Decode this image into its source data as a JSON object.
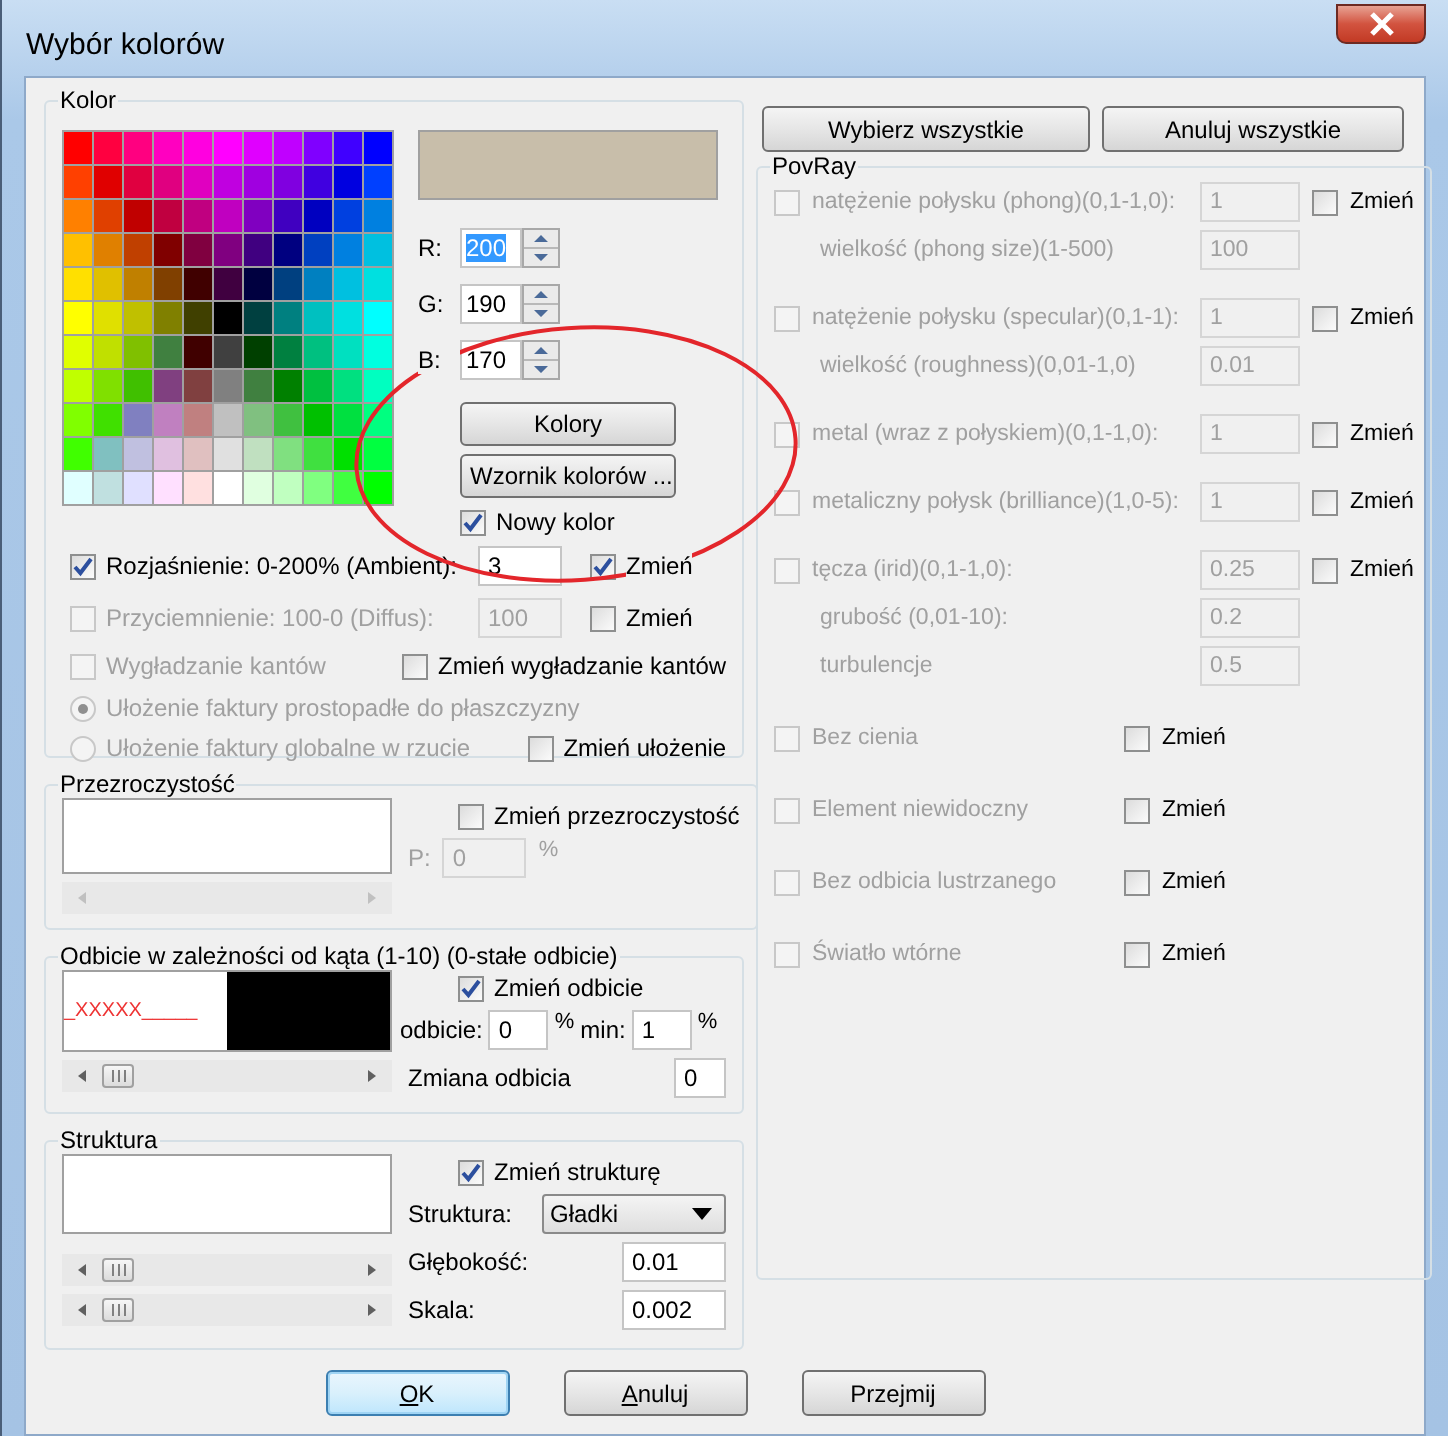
{
  "window": {
    "title": "Wybór kolorów"
  },
  "kolor": {
    "title": "Kolor",
    "palette": [
      {
        "cells": [
          {
            "color": "#ff0000"
          },
          {
            "color": "#ff0040"
          },
          {
            "color": "#ff0080"
          },
          {
            "color": "#ff00c0"
          },
          {
            "color": "#ff00e0"
          },
          {
            "color": "#ff00ff"
          },
          {
            "color": "#e000ff"
          },
          {
            "color": "#c000ff"
          },
          {
            "color": "#8000ff"
          },
          {
            "color": "#4000ff"
          },
          {
            "color": "#0000ff"
          }
        ]
      },
      {
        "cells": [
          {
            "color": "#ff4000"
          },
          {
            "color": "#e00000"
          },
          {
            "color": "#e00040"
          },
          {
            "color": "#e00080"
          },
          {
            "color": "#e000c0"
          },
          {
            "color": "#c000e0"
          },
          {
            "color": "#a000e0"
          },
          {
            "color": "#8000e0"
          },
          {
            "color": "#4000e0"
          },
          {
            "color": "#0000e0"
          },
          {
            "color": "#0040ff"
          }
        ]
      },
      {
        "cells": [
          {
            "color": "#ff8000"
          },
          {
            "color": "#e04000"
          },
          {
            "color": "#c00000"
          },
          {
            "color": "#c00040"
          },
          {
            "color": "#c00080"
          },
          {
            "color": "#c000c0"
          },
          {
            "color": "#8000c0"
          },
          {
            "color": "#4000c0"
          },
          {
            "color": "#0000c0"
          },
          {
            "color": "#0040e0"
          },
          {
            "color": "#0080e0"
          }
        ]
      },
      {
        "cells": [
          {
            "color": "#ffc000"
          },
          {
            "color": "#e08000"
          },
          {
            "color": "#c04000"
          },
          {
            "color": "#800000"
          },
          {
            "color": "#800040"
          },
          {
            "color": "#800080"
          },
          {
            "color": "#400080"
          },
          {
            "color": "#000080"
          },
          {
            "color": "#0040c0"
          },
          {
            "color": "#0080e0"
          },
          {
            "color": "#00c0e0"
          }
        ]
      },
      {
        "cells": [
          {
            "color": "#ffe000"
          },
          {
            "color": "#e0c000"
          },
          {
            "color": "#c08000"
          },
          {
            "color": "#804000"
          },
          {
            "color": "#400000"
          },
          {
            "color": "#400040"
          },
          {
            "color": "#000040"
          },
          {
            "color": "#004080"
          },
          {
            "color": "#0080c0"
          },
          {
            "color": "#00c0e0"
          },
          {
            "color": "#00e0e0"
          }
        ]
      },
      {
        "cells": [
          {
            "color": "#ffff00"
          },
          {
            "color": "#e0e000"
          },
          {
            "color": "#c0c000"
          },
          {
            "color": "#808000"
          },
          {
            "color": "#404000"
          },
          {
            "color": "#000000"
          },
          {
            "color": "#004040"
          },
          {
            "color": "#008080"
          },
          {
            "color": "#00c0c0"
          },
          {
            "color": "#00e0e0"
          },
          {
            "color": "#00ffff"
          }
        ]
      },
      {
        "cells": [
          {
            "color": "#e0ff00"
          },
          {
            "color": "#c0e000"
          },
          {
            "color": "#80c000"
          },
          {
            "color": "#408040"
          },
          {
            "color": "#400000"
          },
          {
            "color": "#404040"
          },
          {
            "color": "#004000"
          },
          {
            "color": "#008040"
          },
          {
            "color": "#00c080"
          },
          {
            "color": "#00e0c0"
          },
          {
            "color": "#00ffe0"
          }
        ]
      },
      {
        "cells": [
          {
            "color": "#c0ff00"
          },
          {
            "color": "#80e000"
          },
          {
            "color": "#40c000"
          },
          {
            "color": "#804080"
          },
          {
            "color": "#804040"
          },
          {
            "color": "#808080"
          },
          {
            "color": "#408040"
          },
          {
            "color": "#008000"
          },
          {
            "color": "#00c040"
          },
          {
            "color": "#00e080"
          },
          {
            "color": "#00ffc0"
          }
        ]
      },
      {
        "cells": [
          {
            "color": "#80ff00"
          },
          {
            "color": "#40e000"
          },
          {
            "color": "#8080c0"
          },
          {
            "color": "#c080c0"
          },
          {
            "color": "#c08080"
          },
          {
            "color": "#c0c0c0"
          },
          {
            "color": "#80c080"
          },
          {
            "color": "#40c040"
          },
          {
            "color": "#00c000"
          },
          {
            "color": "#00e040"
          },
          {
            "color": "#00ff80"
          }
        ]
      },
      {
        "cells": [
          {
            "color": "#40ff00"
          },
          {
            "color": "#80c0c0"
          },
          {
            "color": "#c0c0e0"
          },
          {
            "color": "#e0c0e0"
          },
          {
            "color": "#e0c0c0"
          },
          {
            "color": "#e0e0e0"
          },
          {
            "color": "#c0e0c0"
          },
          {
            "color": "#80e080"
          },
          {
            "color": "#40e040"
          },
          {
            "color": "#00e000"
          },
          {
            "color": "#00ff40"
          }
        ]
      },
      {
        "cells": [
          {
            "color": "#e0ffff"
          },
          {
            "color": "#c0e0e0"
          },
          {
            "color": "#e0e0ff"
          },
          {
            "color": "#ffe0ff"
          },
          {
            "color": "#ffe0e0"
          },
          {
            "color": "#ffffff"
          },
          {
            "color": "#e0ffe0"
          },
          {
            "color": "#c0ffc0"
          },
          {
            "color": "#80ff80"
          },
          {
            "color": "#40ff40"
          },
          {
            "color": "#00ff00"
          }
        ]
      }
    ],
    "channels": [
      {
        "label": "R:",
        "value": "200",
        "selected": true
      },
      {
        "label": "G:",
        "value": "190",
        "selected": false
      },
      {
        "label": "B:",
        "value": "170",
        "selected": false
      }
    ],
    "buttons": [
      "Kolory",
      "Wzornik kolorów ..."
    ],
    "new_color": {
      "label": "Nowy kolor",
      "checked": true
    },
    "ambient": {
      "label": "Rozjaśnienie: 0-200% (Ambient):",
      "checked": true,
      "disabled": false,
      "value": "3",
      "change": {
        "label": "Zmień",
        "checked": true
      }
    },
    "diffuse": {
      "label": "Przyciemnienie: 100-0 (Diffus):",
      "checked": false,
      "disabled": true,
      "value": "100",
      "change": {
        "label": "Zmień",
        "checked": false
      }
    },
    "smoothing": {
      "label": "Wygładzanie kantów",
      "checked": false,
      "disabled": true,
      "change": {
        "label": "Zmień wygładzanie kantów",
        "checked": false
      }
    },
    "placement": {
      "disabled": true,
      "options": [
        {
          "label": "Ułożenie faktury prostopadłe do płaszczyzny",
          "selected": true
        },
        {
          "label": "Ułożenie faktury globalne w rzucie",
          "selected": false
        }
      ],
      "change": {
        "label": "Zmień ułożenie",
        "checked": false
      }
    }
  },
  "transparency": {
    "title": "Przezroczystość",
    "scrollbar_disabled": true,
    "change": {
      "label": "Zmień przezroczystość",
      "checked": false
    },
    "field_disabled": true,
    "field_label": "P:",
    "value": "0",
    "unit": "%"
  },
  "reflection": {
    "title": "Odbicie w zależności od kąta (1-10) (0-stałe odbicie)",
    "preview_text": "_XXXXX_____",
    "scrollbar_disabled": false,
    "change": {
      "label": "Zmień odbicie",
      "checked": true
    },
    "reflection_label": "odbicie:",
    "reflection_value": "0",
    "reflection_unit": "%",
    "min_label": "min:",
    "min_value": "1",
    "min_unit": "%",
    "variation_label": "Zmiana odbicia",
    "variation_value": "0"
  },
  "structure": {
    "title": "Struktura",
    "scrollbar_disabled": false,
    "change": {
      "label": "Zmień strukturę",
      "checked": true
    },
    "structure_label": "Struktura:",
    "structure_value": "Gładki",
    "depth_label": "Głębokość:",
    "depth_value": "0.01",
    "scale_label": "Skala:",
    "scale_value": "0.002"
  },
  "select_buttons": [
    "Wybierz wszystkie",
    "Anuluj wszystkie"
  ],
  "povray": {
    "title": "PovRay",
    "disabled": true,
    "groups": [
      [
        {
          "kind": "param",
          "label": "natężenie połysku (phong)(0,1-1,0):",
          "checked": false,
          "value": "1",
          "change": {
            "label": "Zmień",
            "checked": false
          }
        },
        {
          "kind": "sub",
          "label": "wielkość (phong size)(1-500)",
          "value": "100"
        }
      ],
      [
        {
          "kind": "param",
          "label": "natężenie połysku (specular)(0,1-1):",
          "checked": false,
          "value": "1",
          "change": {
            "label": "Zmień",
            "checked": false
          }
        },
        {
          "kind": "sub",
          "label": "wielkość (roughness)(0,01-1,0)",
          "value": "0.01"
        }
      ],
      [
        {
          "kind": "param",
          "label": "metal (wraz z połyskiem)(0,1-1,0):",
          "checked": false,
          "value": "1",
          "change": {
            "label": "Zmień",
            "checked": false
          }
        }
      ],
      [
        {
          "kind": "param",
          "label": "metaliczny połysk (brilliance)(1,0-5):",
          "checked": false,
          "value": "1",
          "change": {
            "label": "Zmień",
            "checked": false
          }
        }
      ],
      [
        {
          "kind": "param",
          "label": "tęcza (irid)(0,1-1,0):",
          "checked": false,
          "value": "0.25",
          "change": {
            "label": "Zmień",
            "checked": false
          }
        },
        {
          "kind": "sub",
          "label": "grubość (0,01-10):",
          "value": "0.2"
        },
        {
          "kind": "sub",
          "label": "turbulencje",
          "value": "0.5"
        }
      ],
      [
        {
          "kind": "flag",
          "label": "Bez cienia",
          "checked": false,
          "change": {
            "label": "Zmień",
            "checked": false
          }
        }
      ],
      [
        {
          "kind": "flag",
          "label": "Element niewidoczny",
          "checked": false,
          "change": {
            "label": "Zmień",
            "checked": false
          }
        }
      ],
      [
        {
          "kind": "flag",
          "label": "Bez odbicia lustrzanego",
          "checked": false,
          "change": {
            "label": "Zmień",
            "checked": false
          }
        }
      ],
      [
        {
          "kind": "flag",
          "label": "Światło wtórne",
          "checked": false,
          "change": {
            "label": "Zmień",
            "checked": false
          }
        }
      ]
    ]
  },
  "dialog_buttons": [
    {
      "label": "OK",
      "default": true,
      "underline_first": true
    },
    {
      "label": "Anuluj",
      "default": false,
      "underline_first": true
    },
    {
      "label": "Przejmij",
      "default": false,
      "underline_first": false
    }
  ],
  "annotations": [
    {
      "kind": "ellipse",
      "color": "#e3262b"
    }
  ]
}
